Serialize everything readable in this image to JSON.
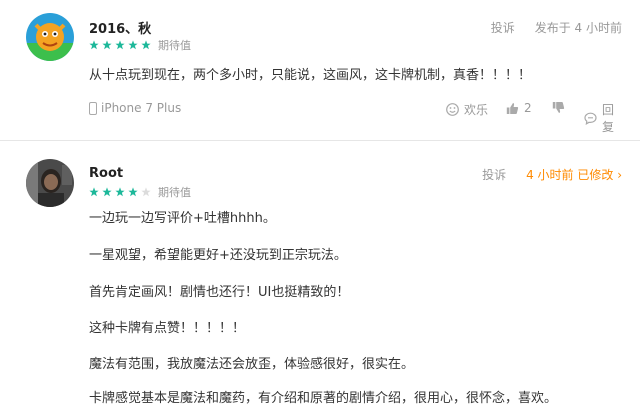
{
  "reviews": [
    {
      "username": "2016、秋",
      "rating": 5,
      "rating_label": "期待值",
      "report_label": "投诉",
      "time_label": "发布于 4 小时前",
      "content": [
        "从十点玩到现在，两个多小时，只能说，这画风，这卡牌机制，真香！！！！"
      ],
      "device": "iPhone 7 Plus",
      "actions": {
        "fun": "欢乐",
        "likes": "2",
        "reply": "回复"
      }
    },
    {
      "username": "Root",
      "rating": 4,
      "rating_label": "期待值",
      "report_label": "投诉",
      "time_label": "4 小时前 已修改 ›",
      "content": [
        "一边玩一边写评价+吐槽hhhh。",
        "一星观望，希望能更好+还没玩到正宗玩法。",
        "首先肯定画风！剧情也还行！UI也挺精致的！",
        "这种卡牌有点赞！！！！！",
        "魔法有范围，我放魔法还会放歪，体验感很好，很实在。",
        "卡牌感觉基本是魔法和魔药，有介绍和原著的剧情介绍，很用心，很怀念，喜欢。"
      ]
    }
  ],
  "colors": {
    "star": "#1db89a",
    "star_empty": "#dcdcdc",
    "accent": "#ff8a00",
    "muted": "#999999"
  }
}
